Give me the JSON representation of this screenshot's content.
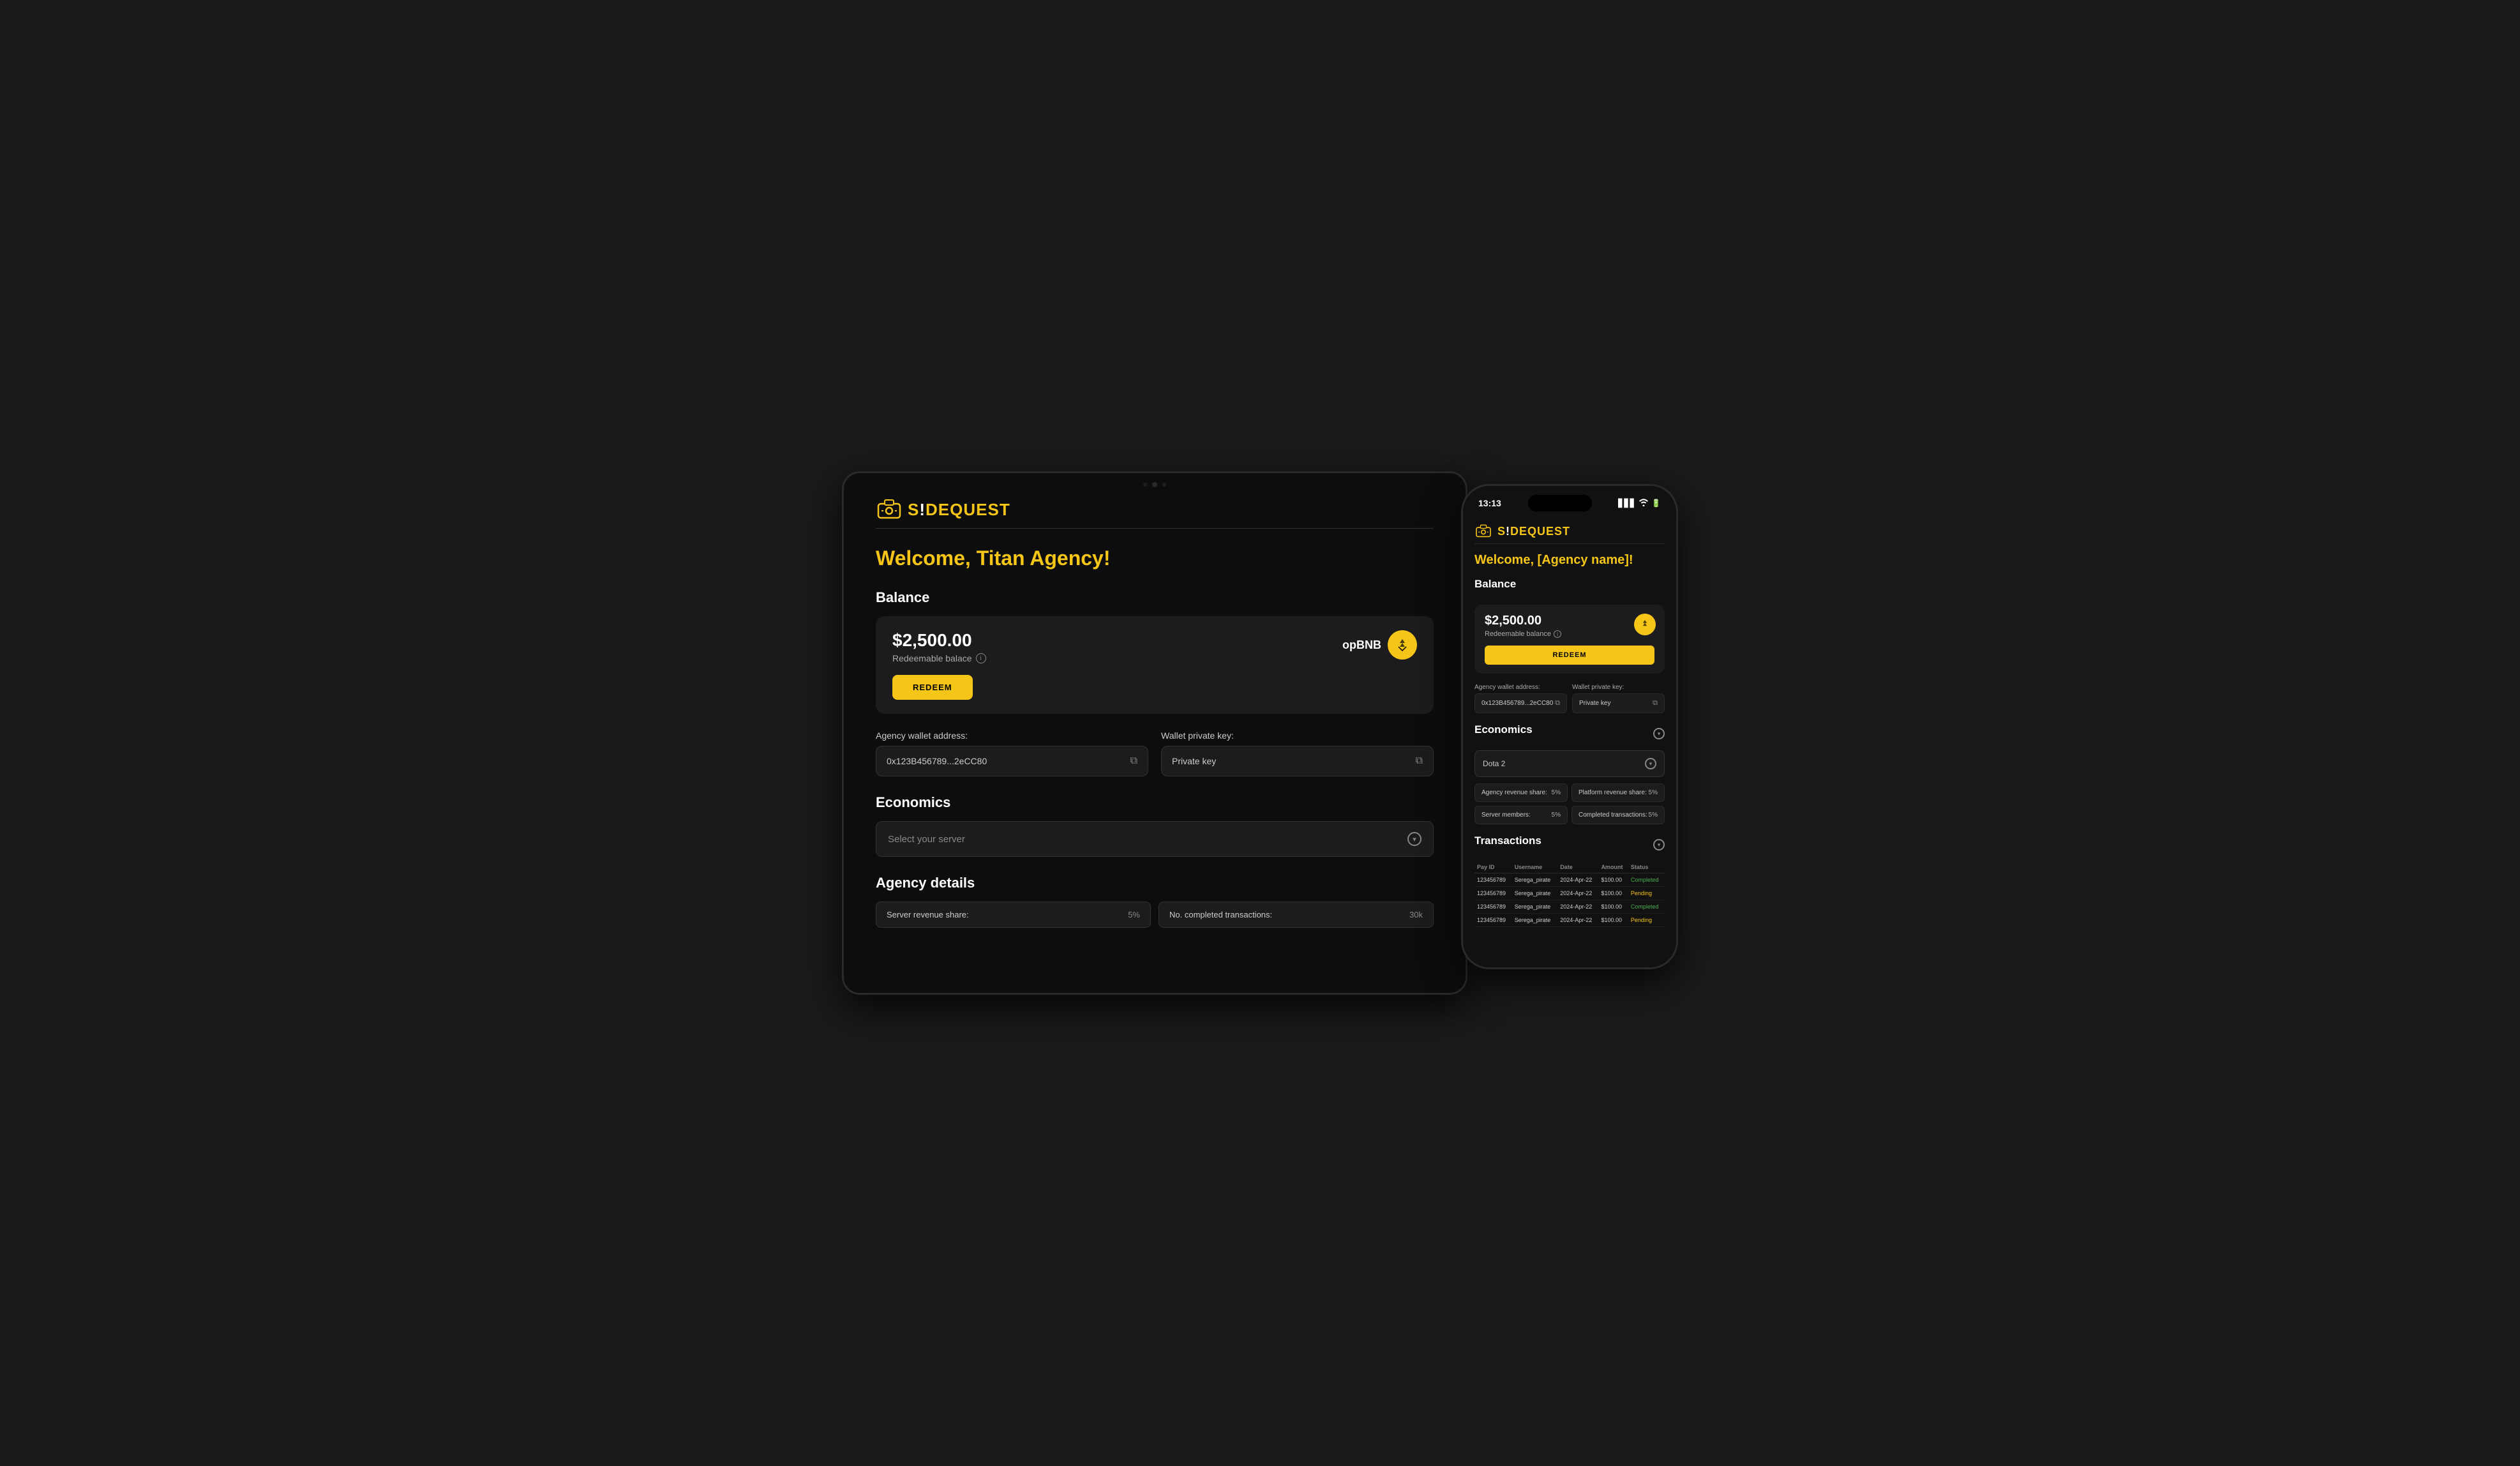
{
  "tablet": {
    "welcome": "Welcome, Titan Agency!",
    "balance_section": "Balance",
    "balance_amount": "$2,500.00",
    "balance_label": "Redeemable balace",
    "token_name": "opBNB",
    "redeem_btn": "REDEEM",
    "wallet_address_label": "Agency wallet address:",
    "wallet_address_value": "0x123B456789...2eCC80",
    "wallet_key_label": "Wallet private key:",
    "wallet_key_placeholder": "Private key",
    "economics_section": "Economics",
    "server_select_placeholder": "Select your server",
    "agency_details_section": "Agency details",
    "server_revenue_label": "Server revenue share:",
    "server_revenue_value": "5%",
    "no_completed_label": "No. completed transactions:",
    "no_completed_value": "30k"
  },
  "phone": {
    "status_time": "13:13",
    "welcome": "Welcome, [Agency name]!",
    "balance_section": "Balance",
    "balance_amount": "$2,500.00",
    "balance_label": "Redeemable balance",
    "redeem_btn": "REDEEM",
    "wallet_address_label": "Agency wallet address:",
    "wallet_address_value": "0x123B456789...2eCC80",
    "wallet_key_label": "Wallet private key:",
    "wallet_key_placeholder": "Private key",
    "economics_section": "Economics",
    "server_select_value": "Dota 2",
    "agency_revenue_label": "Agency revenue share:",
    "agency_revenue_value": "5%",
    "platform_revenue_label": "Platform revenue share:",
    "platform_revenue_value": "5%",
    "server_members_label": "Server members:",
    "server_members_value": "5%",
    "completed_tx_label": "Completed transactions:",
    "completed_tx_value": "5%",
    "transactions_section": "Transactions",
    "transactions": [
      {
        "pay_id": "123456789",
        "username": "Serega_pirate",
        "date": "2024-Apr-22",
        "amount": "$100.00",
        "status": "Completed"
      },
      {
        "pay_id": "123456789",
        "username": "Serega_pirate",
        "date": "2024-Apr-22",
        "amount": "$100.00",
        "status": "Pending"
      },
      {
        "pay_id": "123456789",
        "username": "Serega_pirate",
        "date": "2024-Apr-22",
        "amount": "$100.00",
        "status": "Completed"
      },
      {
        "pay_id": "123456789",
        "username": "Serega_pirate",
        "date": "2024-Apr-22",
        "amount": "$100.00",
        "status": "Pending"
      }
    ],
    "tx_headers": [
      "Pay ID",
      "Username",
      "Date",
      "Amount",
      "Status"
    ]
  },
  "logo": {
    "text_s": "S",
    "text_de": "DE",
    "text_quest": "QUEST",
    "full": "SIDEQUEST"
  }
}
